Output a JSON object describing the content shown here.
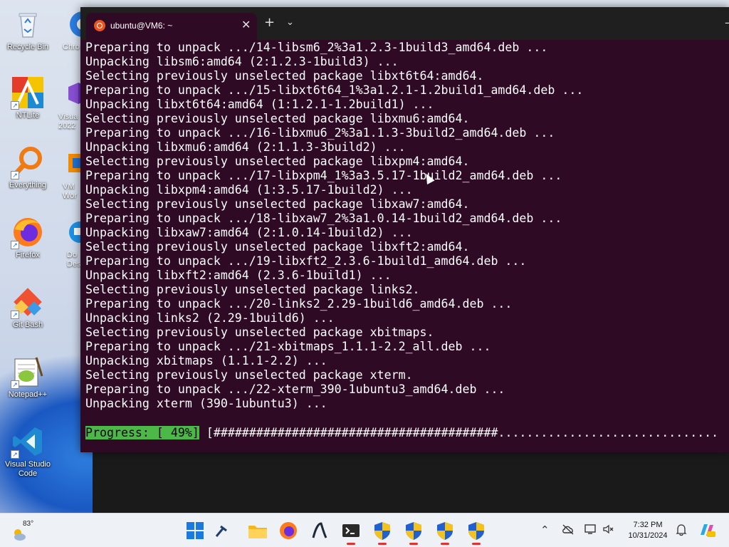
{
  "desktop": {
    "icons": [
      {
        "label": "Recycle Bin",
        "icon": "recycle-bin-icon"
      },
      {
        "label": "NTLite",
        "icon": "ntlite-icon"
      },
      {
        "label": "Everything",
        "icon": "search-magnifier-icon"
      },
      {
        "label": "Firefox",
        "icon": "firefox-icon"
      },
      {
        "label": "Git Bash",
        "icon": "git-icon"
      },
      {
        "label": "Notepad++",
        "icon": "notepad-plus-plus-icon"
      },
      {
        "label": "Visual Studio Code",
        "icon": "vscode-icon"
      }
    ],
    "partial_icons": [
      {
        "label": "Chro",
        "icon": "chrome-icon"
      },
      {
        "label": "Visua\n2022",
        "icon": "visual-studio-icon"
      },
      {
        "label": "VM\nWor",
        "icon": "vmware-icon"
      },
      {
        "label": "Do\nDes",
        "icon": "docker-icon"
      }
    ]
  },
  "terminal": {
    "tab_title": "ubuntu@VM6: ~",
    "tab_close": "✕",
    "new_tab": "+",
    "dropdown": "⌄",
    "minimize": "—",
    "lines": [
      "Preparing to unpack .../14-libsm6_2%3a1.2.3-1build3_amd64.deb ...",
      "Unpacking libsm6:amd64 (2:1.2.3-1build3) ...",
      "Selecting previously unselected package libxt6t64:amd64.",
      "Preparing to unpack .../15-libxt6t64_1%3a1.2.1-1.2build1_amd64.deb ...",
      "Unpacking libxt6t64:amd64 (1:1.2.1-1.2build1) ...",
      "Selecting previously unselected package libxmu6:amd64.",
      "Preparing to unpack .../16-libxmu6_2%3a1.1.3-3build2_amd64.deb ...",
      "Unpacking libxmu6:amd64 (2:1.1.3-3build2) ...",
      "Selecting previously unselected package libxpm4:amd64.",
      "Preparing to unpack .../17-libxpm4_1%3a3.5.17-1build2_amd64.deb ...",
      "Unpacking libxpm4:amd64 (1:3.5.17-1build2) ...",
      "Selecting previously unselected package libxaw7:amd64.",
      "Preparing to unpack .../18-libxaw7_2%3a1.0.14-1build2_amd64.deb ...",
      "Unpacking libxaw7:amd64 (2:1.0.14-1build2) ...",
      "Selecting previously unselected package libxft2:amd64.",
      "Preparing to unpack .../19-libxft2_2.3.6-1build1_amd64.deb ...",
      "Unpacking libxft2:amd64 (2.3.6-1build1) ...",
      "Selecting previously unselected package links2.",
      "Preparing to unpack .../20-links2_2.29-1build6_amd64.deb ...",
      "Unpacking links2 (2.29-1build6) ...",
      "Selecting previously unselected package xbitmaps.",
      "Preparing to unpack .../21-xbitmaps_1.1.1-2.2_all.deb ...",
      "Unpacking xbitmaps (1.1.1-2.2) ...",
      "Selecting previously unselected package xterm.",
      "Preparing to unpack .../22-xterm_390-1ubuntu3_amd64.deb ...",
      "Unpacking xterm (390-1ubuntu3) ..."
    ],
    "progress": {
      "label": "Progress: [ 49%]",
      "bar": "[########################################..............................."
    },
    "colors": {
      "background": "#2f0a24",
      "progress_label_bg": "#4cb848"
    }
  },
  "taskbar": {
    "weather_temp": "83°",
    "time": "7:32 PM",
    "date": "10/31/2024",
    "apps": [
      {
        "icon": "windows-start-icon"
      },
      {
        "icon": "pin-tool-icon"
      },
      {
        "icon": "file-explorer-icon"
      },
      {
        "icon": "firefox-icon"
      },
      {
        "icon": "inkscape-icon"
      },
      {
        "icon": "terminal-icon"
      },
      {
        "icon": "shield-icon"
      },
      {
        "icon": "shield-icon"
      },
      {
        "icon": "shield-icon"
      },
      {
        "icon": "shield-icon"
      }
    ],
    "tray": [
      {
        "icon": "chevron-up-icon"
      },
      {
        "icon": "cloud-off-icon"
      },
      {
        "icon": "display-icon"
      },
      {
        "icon": "volume-muted-icon"
      },
      {
        "icon": "bell-icon"
      },
      {
        "icon": "copilot-icon"
      }
    ]
  }
}
